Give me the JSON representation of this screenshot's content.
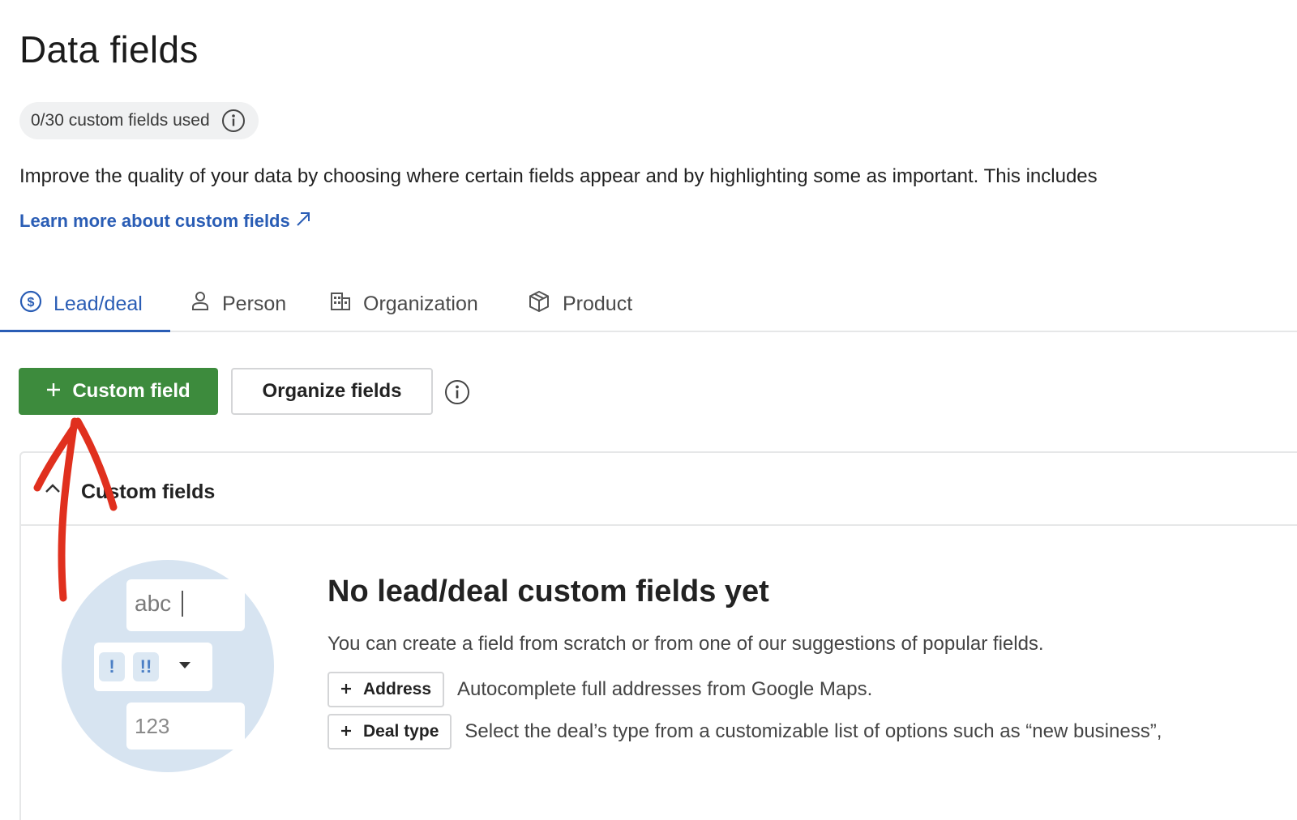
{
  "page": {
    "title": "Data fields",
    "usage": "0/30 custom fields used",
    "description": "Improve the quality of your data by choosing where certain fields appear and by highlighting some as important. This includes",
    "learn_more": "Learn more about custom fields"
  },
  "tabs": [
    {
      "label": "Lead/deal",
      "icon": "dollar-circle-icon",
      "active": true
    },
    {
      "label": "Person",
      "icon": "person-icon",
      "active": false
    },
    {
      "label": "Organization",
      "icon": "building-icon",
      "active": false
    },
    {
      "label": "Product",
      "icon": "box-icon",
      "active": false
    }
  ],
  "actions": {
    "custom_field": "Custom field",
    "organize_fields": "Organize fields"
  },
  "panel": {
    "title": "Custom fields",
    "empty_title": "No lead/deal custom fields yet",
    "empty_subtitle": "You can create a field from scratch or from one of our suggestions of popular fields.",
    "illustration": {
      "text_sample": "abc",
      "chip_1": "!",
      "chip_2": "!!",
      "number_sample": "123"
    },
    "suggestions": [
      {
        "label": "Address",
        "description": "Autocomplete full addresses from Google Maps."
      },
      {
        "label": "Deal type",
        "description": "Select the deal’s type from a customizable list of options such as “new business”,"
      }
    ]
  },
  "colors": {
    "primary_green": "#3d8b3d",
    "link_blue": "#2a5db5",
    "annotation_red": "#e0301e",
    "illustration_bg": "#d7e4f1"
  }
}
